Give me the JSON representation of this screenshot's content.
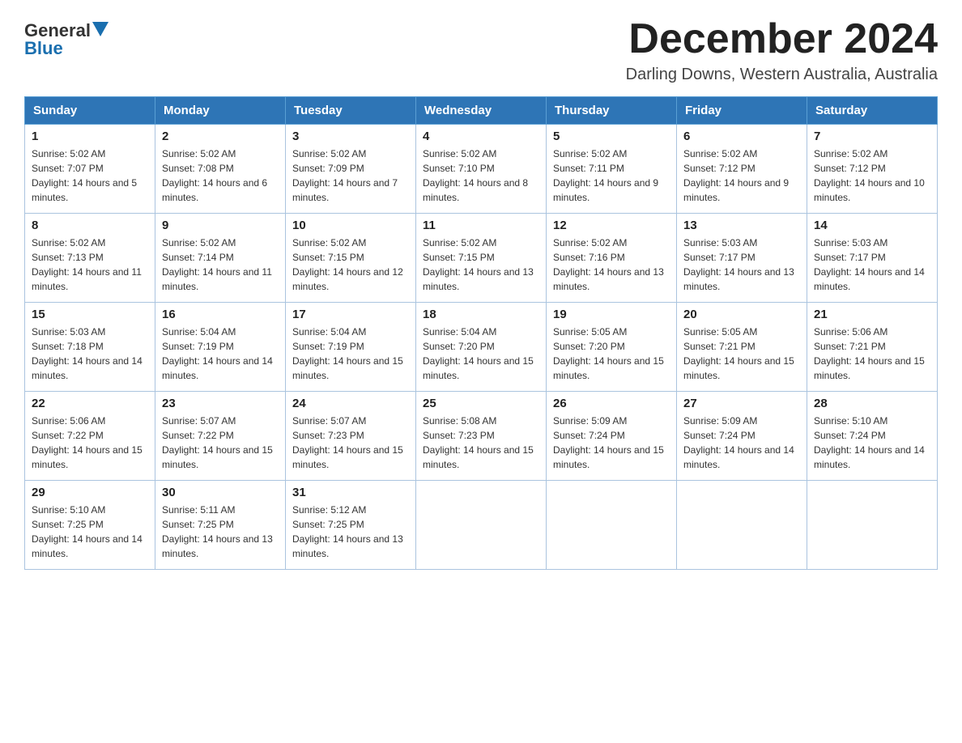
{
  "header": {
    "logo_general": "General",
    "logo_blue": "Blue",
    "title": "December 2024",
    "subtitle": "Darling Downs, Western Australia, Australia"
  },
  "days_of_week": [
    "Sunday",
    "Monday",
    "Tuesday",
    "Wednesday",
    "Thursday",
    "Friday",
    "Saturday"
  ],
  "weeks": [
    [
      {
        "day": "1",
        "sunrise": "5:02 AM",
        "sunset": "7:07 PM",
        "daylight": "14 hours and 5 minutes."
      },
      {
        "day": "2",
        "sunrise": "5:02 AM",
        "sunset": "7:08 PM",
        "daylight": "14 hours and 6 minutes."
      },
      {
        "day": "3",
        "sunrise": "5:02 AM",
        "sunset": "7:09 PM",
        "daylight": "14 hours and 7 minutes."
      },
      {
        "day": "4",
        "sunrise": "5:02 AM",
        "sunset": "7:10 PM",
        "daylight": "14 hours and 8 minutes."
      },
      {
        "day": "5",
        "sunrise": "5:02 AM",
        "sunset": "7:11 PM",
        "daylight": "14 hours and 9 minutes."
      },
      {
        "day": "6",
        "sunrise": "5:02 AM",
        "sunset": "7:12 PM",
        "daylight": "14 hours and 9 minutes."
      },
      {
        "day": "7",
        "sunrise": "5:02 AM",
        "sunset": "7:12 PM",
        "daylight": "14 hours and 10 minutes."
      }
    ],
    [
      {
        "day": "8",
        "sunrise": "5:02 AM",
        "sunset": "7:13 PM",
        "daylight": "14 hours and 11 minutes."
      },
      {
        "day": "9",
        "sunrise": "5:02 AM",
        "sunset": "7:14 PM",
        "daylight": "14 hours and 11 minutes."
      },
      {
        "day": "10",
        "sunrise": "5:02 AM",
        "sunset": "7:15 PM",
        "daylight": "14 hours and 12 minutes."
      },
      {
        "day": "11",
        "sunrise": "5:02 AM",
        "sunset": "7:15 PM",
        "daylight": "14 hours and 13 minutes."
      },
      {
        "day": "12",
        "sunrise": "5:02 AM",
        "sunset": "7:16 PM",
        "daylight": "14 hours and 13 minutes."
      },
      {
        "day": "13",
        "sunrise": "5:03 AM",
        "sunset": "7:17 PM",
        "daylight": "14 hours and 13 minutes."
      },
      {
        "day": "14",
        "sunrise": "5:03 AM",
        "sunset": "7:17 PM",
        "daylight": "14 hours and 14 minutes."
      }
    ],
    [
      {
        "day": "15",
        "sunrise": "5:03 AM",
        "sunset": "7:18 PM",
        "daylight": "14 hours and 14 minutes."
      },
      {
        "day": "16",
        "sunrise": "5:04 AM",
        "sunset": "7:19 PM",
        "daylight": "14 hours and 14 minutes."
      },
      {
        "day": "17",
        "sunrise": "5:04 AM",
        "sunset": "7:19 PM",
        "daylight": "14 hours and 15 minutes."
      },
      {
        "day": "18",
        "sunrise": "5:04 AM",
        "sunset": "7:20 PM",
        "daylight": "14 hours and 15 minutes."
      },
      {
        "day": "19",
        "sunrise": "5:05 AM",
        "sunset": "7:20 PM",
        "daylight": "14 hours and 15 minutes."
      },
      {
        "day": "20",
        "sunrise": "5:05 AM",
        "sunset": "7:21 PM",
        "daylight": "14 hours and 15 minutes."
      },
      {
        "day": "21",
        "sunrise": "5:06 AM",
        "sunset": "7:21 PM",
        "daylight": "14 hours and 15 minutes."
      }
    ],
    [
      {
        "day": "22",
        "sunrise": "5:06 AM",
        "sunset": "7:22 PM",
        "daylight": "14 hours and 15 minutes."
      },
      {
        "day": "23",
        "sunrise": "5:07 AM",
        "sunset": "7:22 PM",
        "daylight": "14 hours and 15 minutes."
      },
      {
        "day": "24",
        "sunrise": "5:07 AM",
        "sunset": "7:23 PM",
        "daylight": "14 hours and 15 minutes."
      },
      {
        "day": "25",
        "sunrise": "5:08 AM",
        "sunset": "7:23 PM",
        "daylight": "14 hours and 15 minutes."
      },
      {
        "day": "26",
        "sunrise": "5:09 AM",
        "sunset": "7:24 PM",
        "daylight": "14 hours and 15 minutes."
      },
      {
        "day": "27",
        "sunrise": "5:09 AM",
        "sunset": "7:24 PM",
        "daylight": "14 hours and 14 minutes."
      },
      {
        "day": "28",
        "sunrise": "5:10 AM",
        "sunset": "7:24 PM",
        "daylight": "14 hours and 14 minutes."
      }
    ],
    [
      {
        "day": "29",
        "sunrise": "5:10 AM",
        "sunset": "7:25 PM",
        "daylight": "14 hours and 14 minutes."
      },
      {
        "day": "30",
        "sunrise": "5:11 AM",
        "sunset": "7:25 PM",
        "daylight": "14 hours and 13 minutes."
      },
      {
        "day": "31",
        "sunrise": "5:12 AM",
        "sunset": "7:25 PM",
        "daylight": "14 hours and 13 minutes."
      },
      null,
      null,
      null,
      null
    ]
  ],
  "labels": {
    "sunrise": "Sunrise:",
    "sunset": "Sunset:",
    "daylight": "Daylight:"
  }
}
